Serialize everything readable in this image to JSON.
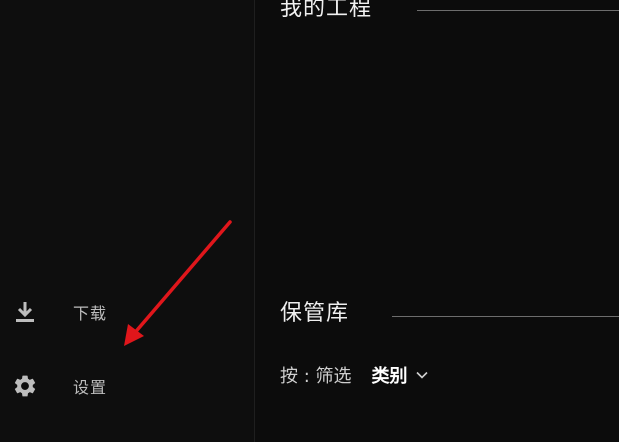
{
  "sidebar": {
    "items": [
      {
        "label": "下载",
        "icon": "download-icon"
      },
      {
        "label": "设置",
        "icon": "gear-icon"
      }
    ]
  },
  "main": {
    "sections": [
      {
        "title": "我的工程"
      },
      {
        "title": "保管库"
      }
    ],
    "filter": {
      "label": "按 : 筛选",
      "value": "类别",
      "icon": "chevron-down-icon"
    }
  },
  "annotation": {
    "color": "#e0161b"
  }
}
